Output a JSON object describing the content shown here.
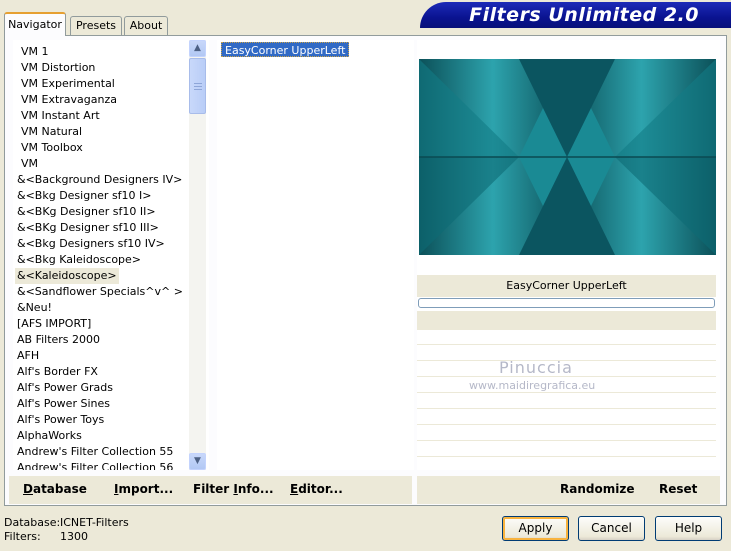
{
  "app": {
    "title": "Filters Unlimited 2.0"
  },
  "tabs": [
    {
      "label": "Navigator",
      "active": true
    },
    {
      "label": "Presets",
      "active": false
    },
    {
      "label": "About",
      "active": false
    }
  ],
  "categories": {
    "selected_index": 14,
    "items": [
      "VM 1",
      "VM Distortion",
      "VM Experimental",
      "VM Extravaganza",
      "VM Instant Art",
      "VM Natural",
      "VM Toolbox",
      "VM",
      "&<Background Designers IV>",
      "&<Bkg Designer sf10 I>",
      "&<BKg Designer sf10 II>",
      "&<BKg Designer sf10 III>",
      "&<Bkg Designers sf10 IV>",
      "&<Bkg Kaleidoscope>",
      "&<Kaleidoscope>",
      "&<Sandflower Specials^v^ >",
      "&Neu!",
      "[AFS IMPORT]",
      "AB Filters 2000",
      "AFH",
      "Alf's Border FX",
      "Alf's Power Grads",
      "Alf's Power Sines",
      "Alf's Power Toys",
      "AlphaWorks",
      "Andrew's Filter Collection 55",
      "Andrew's Filter Collection 56"
    ]
  },
  "filters": {
    "items": [
      "EasyCorner UpperLeft"
    ],
    "selected": "EasyCorner UpperLeft"
  },
  "preview": {
    "filter_name": "EasyCorner UpperLeft",
    "progress": 0,
    "watermark_name": "Pinuccia",
    "watermark_url": "www.maidiregrafica.eu",
    "colors": {
      "base": "#0f6f78",
      "light": "#2fa6b0",
      "dark": "#0a4a52"
    }
  },
  "toolbar": {
    "database_first": "D",
    "database_rest": "atabase",
    "import_first": "I",
    "import_rest": "mport...",
    "filterinfo_pre": "Filter ",
    "filterinfo_u": "I",
    "filterinfo_post": "nfo...",
    "editor_first": "E",
    "editor_rest": "ditor...",
    "randomize": "Randomize",
    "reset": "Reset"
  },
  "footer": {
    "database_label": "Database:",
    "database_value": "ICNET-Filters",
    "filters_label": "Filters:",
    "filters_value": "1300"
  },
  "buttons": {
    "apply": "Apply",
    "cancel": "Cancel",
    "help": "Help"
  }
}
